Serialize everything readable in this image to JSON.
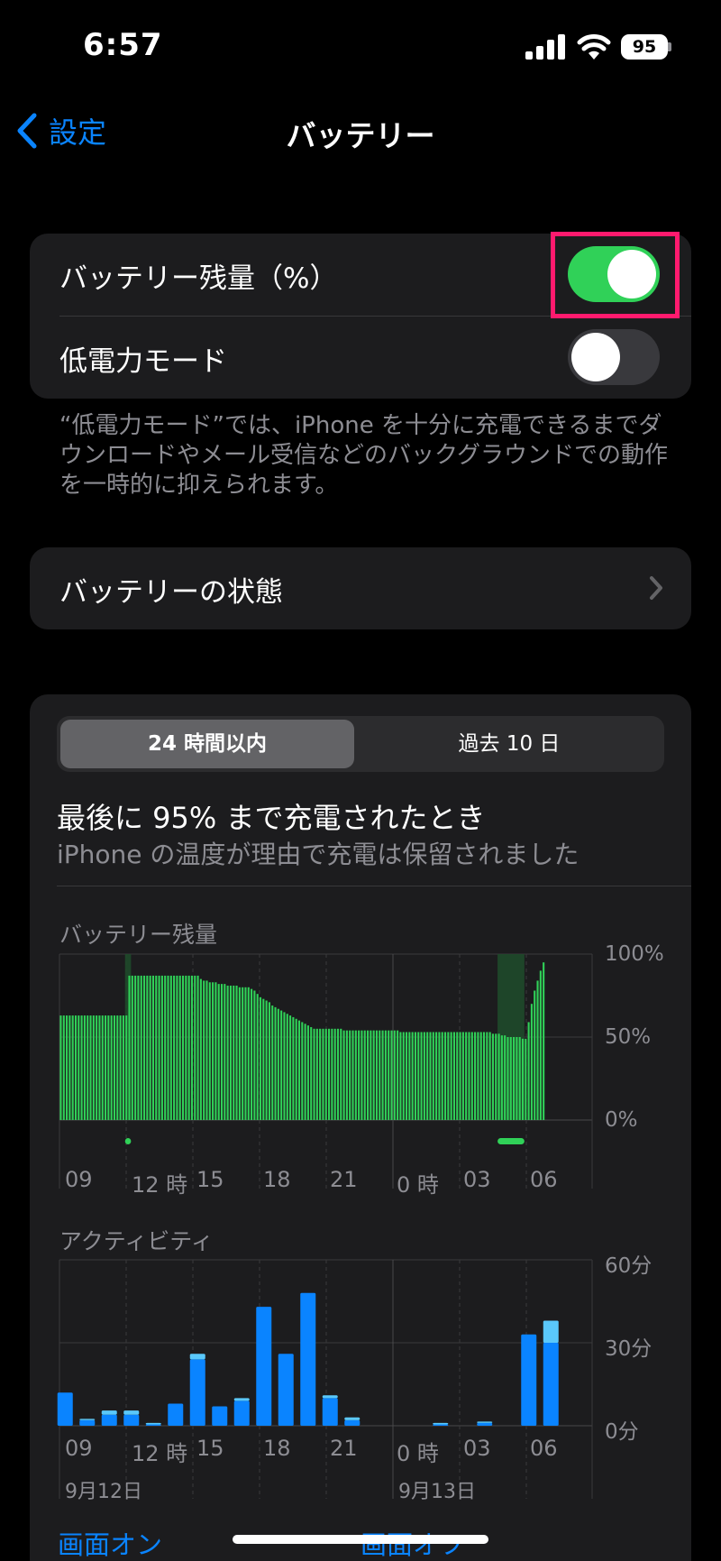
{
  "status_bar": {
    "time": "6:57",
    "battery_percent": "95"
  },
  "nav": {
    "back_label": "設定",
    "title": "バッテリー"
  },
  "settings": {
    "battery_percentage": {
      "label": "バッテリー残量（%）",
      "enabled": true
    },
    "low_power_mode": {
      "label": "低電力モード",
      "enabled": false
    },
    "footnote": "“低電力モード”では、iPhone を十分に充電できるまでダウンロードやメール受信などのバックグラウンドでの動作を一時的に抑えられます。",
    "battery_health_label": "バッテリーの状態"
  },
  "usage": {
    "segments": [
      "24 時間以内",
      "過去 10 日"
    ],
    "selected_segment": 0,
    "charge_title": "最後に 95% まで充電されたとき",
    "charge_subtitle": "iPhone の温度が理由で充電は保留されました",
    "battery_chart_title": "バッテリー残量",
    "activity_chart_title": "アクティビティ",
    "legend": {
      "screen_on": "画面オン",
      "screen_off": "画面オフ"
    }
  },
  "colors": {
    "accent": "#0a84ff",
    "battery_bar": "#30d158",
    "activity_on": "#0a84ff",
    "activity_off": "#5ac8fa",
    "toggle_on": "#30d158",
    "highlight": "#ff1a6e"
  },
  "chart_data": [
    {
      "type": "bar",
      "title": "バッテリー残量",
      "x_tick_labels": [
        "09",
        "12 時",
        "15",
        "18",
        "21",
        "0 時",
        "03",
        "06"
      ],
      "y_tick_labels": [
        "100%",
        "50%",
        "0%"
      ],
      "ylim": [
        0,
        100
      ],
      "charging_periods": [
        [
          22,
          23
        ],
        [
          147,
          155
        ]
      ],
      "values": [
        63,
        63,
        63,
        63,
        63,
        63,
        63,
        63,
        63,
        63,
        63,
        63,
        63,
        63,
        63,
        63,
        63,
        63,
        63,
        63,
        63,
        63,
        63,
        87,
        87,
        87,
        87,
        87,
        87,
        87,
        87,
        87,
        87,
        87,
        87,
        87,
        87,
        87,
        87,
        87,
        87,
        87,
        87,
        87,
        87,
        87,
        87,
        85,
        84,
        84,
        83,
        83,
        83,
        82,
        82,
        82,
        81,
        81,
        81,
        81,
        80,
        80,
        80,
        80,
        79,
        78,
        76,
        74,
        73,
        72,
        71,
        69,
        68,
        67,
        66,
        65,
        64,
        63,
        62,
        61,
        60,
        59,
        58,
        57,
        56,
        55,
        55,
        55,
        55,
        55,
        55,
        55,
        55,
        55,
        55,
        54,
        54,
        54,
        54,
        54,
        54,
        54,
        54,
        54,
        54,
        54,
        54,
        54,
        54,
        54,
        54,
        54,
        54,
        54,
        53,
        53,
        53,
        53,
        53,
        53,
        53,
        53,
        53,
        53,
        53,
        53,
        53,
        53,
        53,
        53,
        53,
        53,
        53,
        53,
        53,
        53,
        53,
        53,
        53,
        53,
        53,
        53,
        53,
        53,
        53,
        52,
        52,
        52,
        51,
        51,
        50,
        50,
        50,
        50,
        50,
        49,
        49,
        59,
        70,
        78,
        84,
        90,
        95
      ],
      "grid": true
    },
    {
      "type": "bar",
      "title": "アクティビティ",
      "x_tick_labels": [
        "09",
        "12 時",
        "15",
        "18",
        "21",
        "0 時",
        "03",
        "06"
      ],
      "date_labels": [
        "9月12日",
        "9月13日"
      ],
      "y_tick_labels": [
        "60分",
        "30分",
        "0分"
      ],
      "ylim": [
        0,
        60
      ],
      "series": [
        {
          "name": "画面オン",
          "values": [
            12,
            2,
            4,
            4,
            0.5,
            8,
            24,
            7,
            9,
            43,
            26,
            48,
            10,
            2,
            0,
            0,
            0,
            0.5,
            0,
            1,
            0,
            33,
            30
          ]
        },
        {
          "name": "画面オフ",
          "values": [
            0,
            0.5,
            1.5,
            1.5,
            0.5,
            0,
            2,
            0,
            1,
            0,
            0,
            0,
            1,
            1,
            0,
            0,
            0,
            0.5,
            0,
            0.5,
            0,
            0,
            8
          ]
        }
      ],
      "grid": true
    }
  ]
}
